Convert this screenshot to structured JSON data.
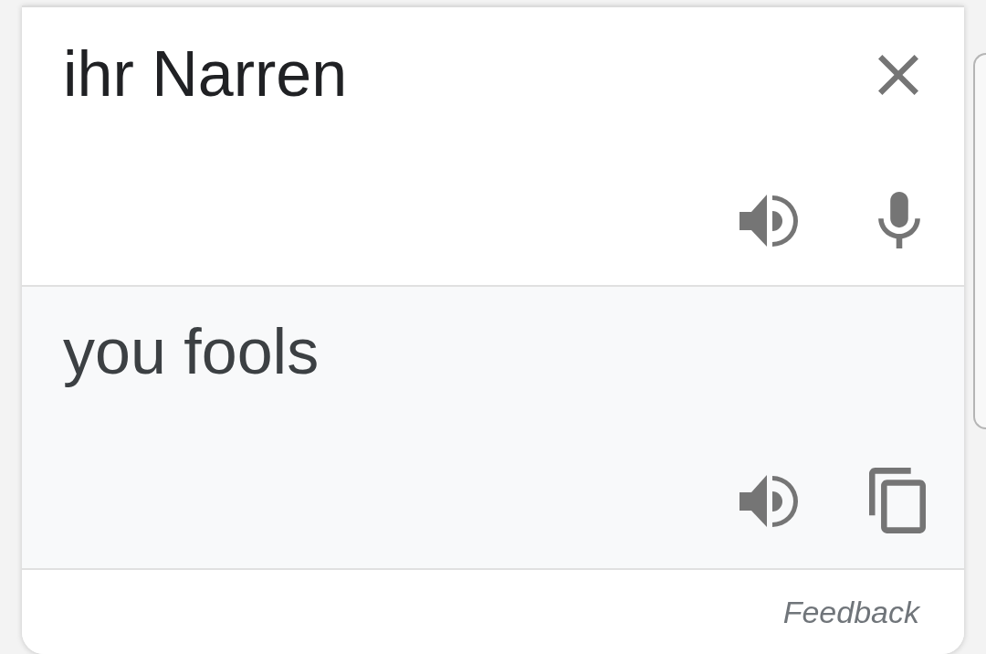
{
  "source": {
    "text": "ihr Narren"
  },
  "translation": {
    "text": "you fools"
  },
  "footer": {
    "link": "Feedback"
  }
}
